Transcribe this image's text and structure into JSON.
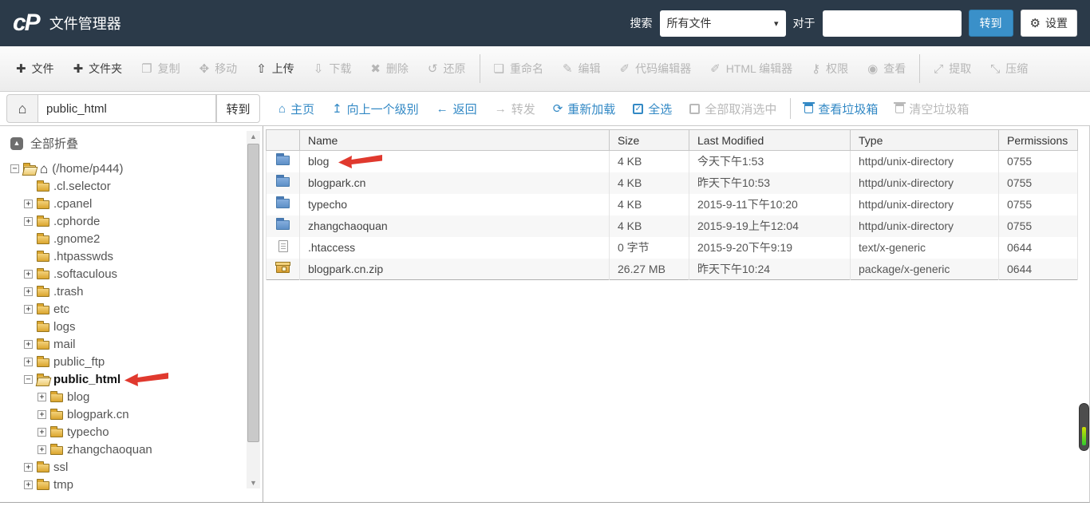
{
  "colors": {
    "hdr": "#2b3a49",
    "accent": "#3a90c9",
    "link": "#3389c5",
    "red": "#e0392e"
  },
  "icons": {
    "plus": "✚",
    "copy": "❐",
    "move": "✥",
    "upload": "⇧",
    "download": "⇩",
    "delete": "✖",
    "restore": "↺",
    "rename": "❏",
    "edit": "✎",
    "code-editor": "✐",
    "html-editor": "✐",
    "permissions": "⚷",
    "view": "◉",
    "extract": "⤢",
    "compress": "⤡",
    "gear": "⚙",
    "home": "⌂",
    "up-level": "↥",
    "arrow-left": "←",
    "arrow-right": "→",
    "refresh": "⟳",
    "caret": "▾",
    "check": "✓",
    "collapse": "▲",
    "scroll-up": "▲",
    "scroll-down": "▼",
    "expand-plus": "+",
    "expand-minus": "−"
  },
  "header": {
    "logo": "cP",
    "title": "文件管理器",
    "search_label": "搜索",
    "search_scope": "所有文件",
    "for_label": "对于",
    "search_value": "",
    "go_button": "转到",
    "settings_button": "设置"
  },
  "toolbar": {
    "items": [
      {
        "id": "add-file",
        "label": "文件",
        "icon": "plus",
        "enabled": true
      },
      {
        "id": "add-folder",
        "label": "文件夹",
        "icon": "plus",
        "enabled": true
      },
      {
        "id": "copy",
        "label": "复制",
        "icon": "copy",
        "enabled": false
      },
      {
        "id": "move",
        "label": "移动",
        "icon": "move",
        "enabled": false
      },
      {
        "id": "upload",
        "label": "上传",
        "icon": "upload",
        "enabled": true
      },
      {
        "id": "download",
        "label": "下载",
        "icon": "download",
        "enabled": false
      },
      {
        "id": "delete",
        "label": "删除",
        "icon": "delete",
        "enabled": false
      },
      {
        "id": "restore",
        "label": "还原",
        "icon": "restore",
        "enabled": false,
        "sep_after": true
      },
      {
        "id": "rename",
        "label": "重命名",
        "icon": "rename",
        "enabled": false
      },
      {
        "id": "edit",
        "label": "编辑",
        "icon": "edit",
        "enabled": false
      },
      {
        "id": "code-editor",
        "label": "代码编辑器",
        "icon": "code-editor",
        "enabled": false
      },
      {
        "id": "html-editor",
        "label": "HTML 编辑器",
        "icon": "html-editor",
        "enabled": false
      },
      {
        "id": "permissions",
        "label": "权限",
        "icon": "permissions",
        "enabled": false
      },
      {
        "id": "view",
        "label": "查看",
        "icon": "view",
        "enabled": false,
        "sep_after": true
      },
      {
        "id": "extract",
        "label": "提取",
        "icon": "extract",
        "enabled": false
      },
      {
        "id": "compress",
        "label": "压缩",
        "icon": "compress",
        "enabled": false
      }
    ]
  },
  "sidebar": {
    "path_bar": {
      "value": "public_html",
      "go_button": "转到"
    },
    "collapse_all": "全部折叠",
    "tree": [
      {
        "depth": 0,
        "exp": "minus",
        "icon": "folder-open",
        "home": true,
        "label": "(/home/p444)"
      },
      {
        "depth": 1,
        "exp": null,
        "icon": "folder",
        "label": ".cl.selector"
      },
      {
        "depth": 1,
        "exp": "plus",
        "icon": "folder",
        "label": ".cpanel"
      },
      {
        "depth": 1,
        "exp": "plus",
        "icon": "folder",
        "label": ".cphorde"
      },
      {
        "depth": 1,
        "exp": null,
        "icon": "folder",
        "label": ".gnome2"
      },
      {
        "depth": 1,
        "exp": null,
        "icon": "folder",
        "label": ".htpasswds"
      },
      {
        "depth": 1,
        "exp": "plus",
        "icon": "folder",
        "label": ".softaculous"
      },
      {
        "depth": 1,
        "exp": "plus",
        "icon": "folder",
        "label": ".trash"
      },
      {
        "depth": 1,
        "exp": "plus",
        "icon": "folder",
        "label": "etc"
      },
      {
        "depth": 1,
        "exp": null,
        "icon": "folder",
        "label": "logs"
      },
      {
        "depth": 1,
        "exp": "plus",
        "icon": "folder",
        "label": "mail"
      },
      {
        "depth": 1,
        "exp": "plus",
        "icon": "folder",
        "label": "public_ftp"
      },
      {
        "depth": 1,
        "exp": "minus",
        "icon": "folder-open",
        "label": "public_html",
        "bold": true,
        "arrow": true
      },
      {
        "depth": 2,
        "exp": "plus",
        "icon": "folder",
        "label": "blog"
      },
      {
        "depth": 2,
        "exp": "plus",
        "icon": "folder",
        "label": "blogpark.cn"
      },
      {
        "depth": 2,
        "exp": "plus",
        "icon": "folder",
        "label": "typecho"
      },
      {
        "depth": 2,
        "exp": "plus",
        "icon": "folder",
        "label": "zhangchaoquan"
      },
      {
        "depth": 1,
        "exp": "plus",
        "icon": "folder",
        "label": "ssl"
      },
      {
        "depth": 1,
        "exp": "plus",
        "icon": "folder",
        "label": "tmp"
      }
    ]
  },
  "main": {
    "nav": [
      {
        "id": "home",
        "label": "主页",
        "icon": "home",
        "active": true
      },
      {
        "id": "up-one-level",
        "label": "向上一个级别",
        "icon": "up-level",
        "active": true
      },
      {
        "id": "back",
        "label": "返回",
        "icon": "arrow-left",
        "active": true
      },
      {
        "id": "forward",
        "label": "转发",
        "icon": "arrow-right",
        "active": false
      },
      {
        "id": "reload",
        "label": "重新加载",
        "icon": "refresh",
        "active": true
      },
      {
        "id": "select-all",
        "label": "全选",
        "icon": "checkbox-checked",
        "active": true
      },
      {
        "id": "unselect-all",
        "label": "全部取消选中",
        "icon": "checkbox-empty",
        "active": false,
        "sep_after": true
      },
      {
        "id": "view-trash",
        "label": "查看垃圾箱",
        "icon": "trash",
        "active": true
      },
      {
        "id": "empty-trash",
        "label": "清空垃圾箱",
        "icon": "trash",
        "active": false
      }
    ],
    "table": {
      "columns": [
        "Name",
        "Size",
        "Last Modified",
        "Type",
        "Permissions"
      ],
      "rows": [
        {
          "icon": "folder",
          "name": "blog",
          "arrow": true,
          "size": "4 KB",
          "modified": "今天下午1:53",
          "type": "httpd/unix-directory",
          "perms": "0755"
        },
        {
          "icon": "folder",
          "name": "blogpark.cn",
          "size": "4 KB",
          "modified": "昨天下午10:53",
          "type": "httpd/unix-directory",
          "perms": "0755"
        },
        {
          "icon": "folder",
          "name": "typecho",
          "size": "4 KB",
          "modified": "2015-9-11下午10:20",
          "type": "httpd/unix-directory",
          "perms": "0755"
        },
        {
          "icon": "folder",
          "name": "zhangchaoquan",
          "size": "4 KB",
          "modified": "2015-9-19上午12:04",
          "type": "httpd/unix-directory",
          "perms": "0755"
        },
        {
          "icon": "file",
          "name": ".htaccess",
          "size": "0 字节",
          "modified": "2015-9-20下午9:19",
          "type": "text/x-generic",
          "perms": "0644"
        },
        {
          "icon": "archive",
          "name": "blogpark.cn.zip",
          "size": "26.27 MB",
          "modified": "昨天下午10:24",
          "type": "package/x-generic",
          "perms": "0644"
        }
      ]
    }
  }
}
